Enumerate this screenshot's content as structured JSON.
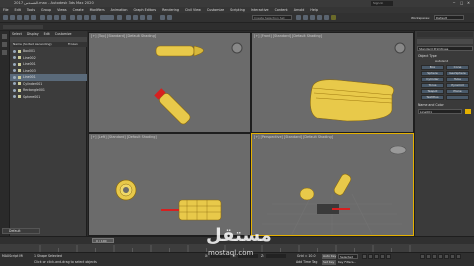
{
  "window": {
    "title": "2017 المسدس.max - Autodesk 3ds Max 2020",
    "search_placeholder": "Sign In"
  },
  "menu": [
    "File",
    "Edit",
    "Tools",
    "Group",
    "Views",
    "Create",
    "Modifiers",
    "Animation",
    "Graph Editors",
    "Rendering",
    "Civil View",
    "Customize",
    "Scripting",
    "Interactive",
    "Content",
    "Arnold",
    "Help"
  ],
  "workspace": {
    "label": "Workspaces:",
    "value": "Default"
  },
  "toolbar": {
    "selection_set": "Create Selection Set"
  },
  "scene_explorer": {
    "tabs": [
      "Select",
      "Display",
      "Edit",
      "Customize"
    ],
    "header": "Name (Sorted Ascending)",
    "frozen_label": "Frozen",
    "items": [
      "Box001",
      "Line002",
      "Line001",
      "Line003",
      "Line001",
      "Cylinder001",
      "Rectangle001",
      "Sphere001"
    ],
    "selected_index": 4
  },
  "viewports": {
    "top": "[+] [Top] [Standard] [Default Shading]",
    "front": "[+] [Front] [Standard] [Default Shading]",
    "left": "[+] [Left] [Standard] [Default Shading]",
    "persp": "[+] [Perspective] [Standard] [Default Shading]"
  },
  "command_panel": {
    "dropdown": "Standard Primitives",
    "section_object_type": "Object Type",
    "autogrid": "AutoGrid",
    "buttons": [
      "Box",
      "Cone",
      "Sphere",
      "GeoSphere",
      "Cylinder",
      "Tube",
      "Torus",
      "Pyramid",
      "Teapot",
      "Plane",
      "TextPlus",
      ""
    ],
    "section_name_color": "Name and Color",
    "name_value": "Line001",
    "color": "#e5b100"
  },
  "layer": {
    "value": "Default"
  },
  "timeline": {
    "frame": "0 / 100"
  },
  "status": {
    "selected": "1 Shape Selected",
    "prompt": "Click or click-and-drag to select objects",
    "x": "X:",
    "y": "Y:",
    "z": "Z:",
    "grid": "Grid = 10.0",
    "add_time_tag": "Add Time Tag",
    "autokey": "Auto Key",
    "selected_mode": "Selected",
    "setkey": "Set Key",
    "key_filters": "Key Filters...",
    "script_prompt": "MAXScript Mi"
  },
  "watermark": {
    "text": "مستقل",
    "sub": "mostaql.com"
  },
  "colors": {
    "accent": "#e5b100",
    "object": "#e8c94a",
    "red": "#d62020"
  }
}
